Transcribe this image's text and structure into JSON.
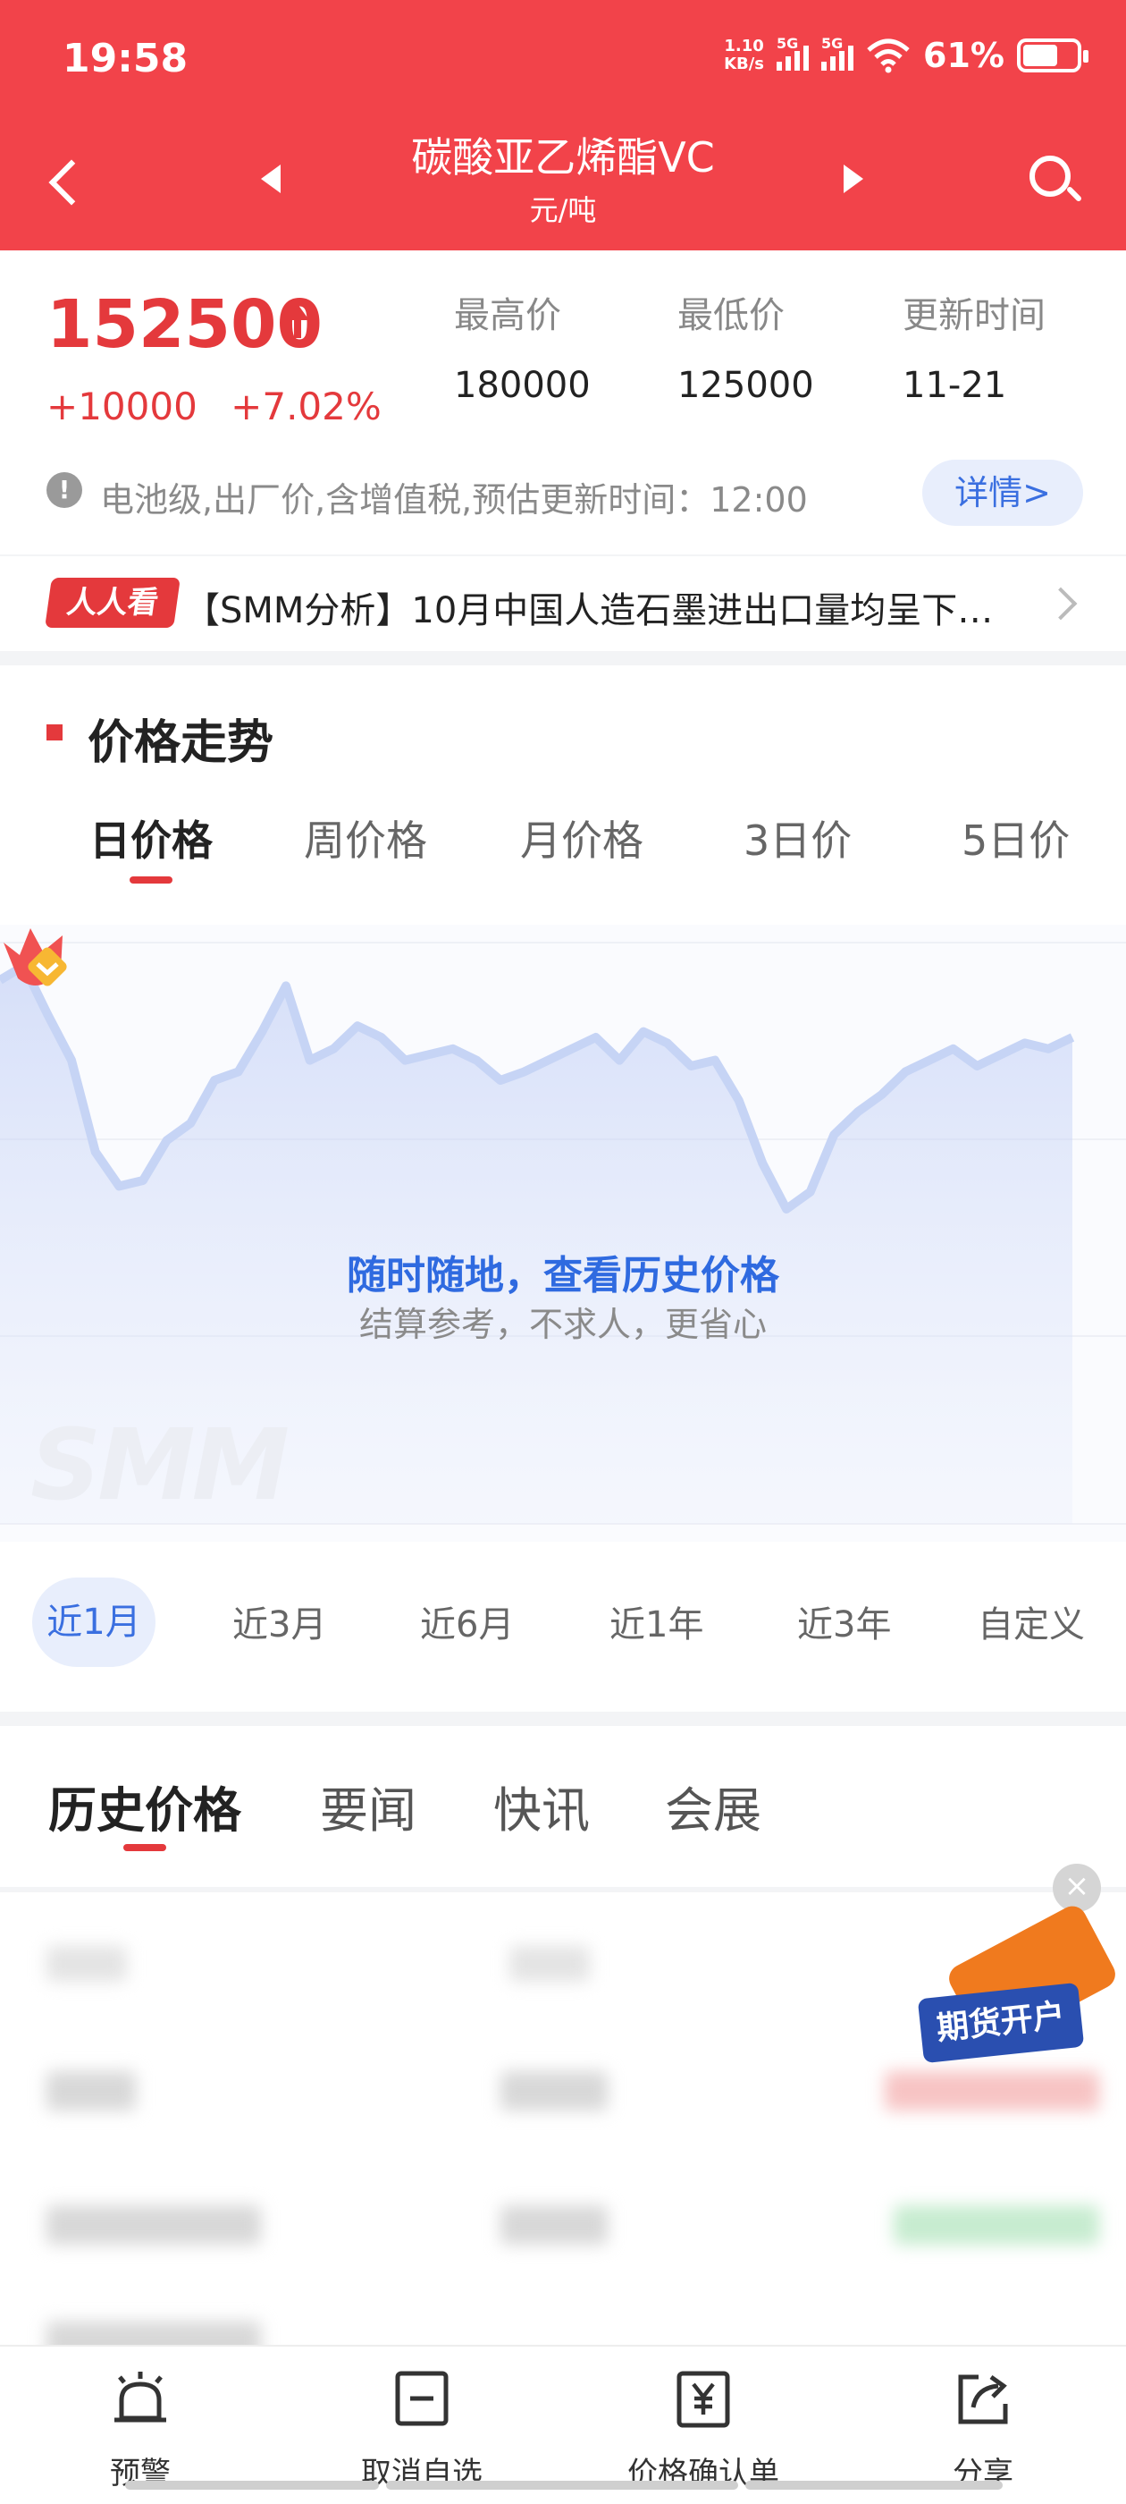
{
  "status_bar": {
    "time": "19:58",
    "net_speed_value": "1.10",
    "net_speed_unit": "KB/s",
    "signal_1": "5G",
    "signal_2": "5G",
    "battery": "61%"
  },
  "nav": {
    "title": "碳酸亚乙烯酯VC",
    "unit": "元/吨"
  },
  "price": {
    "current": "152500",
    "change": "+10000",
    "change_pct": "+7.02%",
    "high_label": "最高价",
    "high_value": "180000",
    "low_label": "最低价",
    "low_value": "125000",
    "update_label": "更新时间",
    "update_value": "11-21",
    "note": "电池级,出厂价,含增值税,预估更新时间：12:00",
    "detail_button": "详情>"
  },
  "ticker": {
    "badge": "人人看",
    "text": "【SMM分析】10月中国人造石墨进出口量均呈下…"
  },
  "trend": {
    "section_title": "价格走势",
    "period_tabs": [
      "日价格",
      "周价格",
      "月价格",
      "3日价",
      "5日价"
    ],
    "active_period": 0,
    "overlay_title": "随时随地，查看历史价格",
    "overlay_subtitle": "结算参考，不求人，更省心",
    "range_tabs": [
      "近1月",
      "近3月",
      "近6月",
      "近1年",
      "近3年",
      "自定义"
    ],
    "active_range": 0
  },
  "chart_data": {
    "type": "area",
    "series": [
      {
        "values": [
          0.9,
          0.95,
          0.78,
          0.62,
          0.3,
          0.18,
          0.2,
          0.34,
          0.4,
          0.55,
          0.58,
          0.72,
          0.88,
          0.62,
          0.66,
          0.74,
          0.7,
          0.62,
          0.64,
          0.66,
          0.62,
          0.55,
          0.58,
          0.62,
          0.66,
          0.7,
          0.62,
          0.72,
          0.68,
          0.6,
          0.62,
          0.48,
          0.26,
          0.1,
          0.16,
          0.36,
          0.44,
          0.5,
          0.58,
          0.62,
          0.66,
          0.6,
          0.64,
          0.68,
          0.66,
          0.7
        ]
      }
    ]
  },
  "info_tabs": {
    "tabs": [
      "历史价格",
      "要闻",
      "快讯",
      "会展"
    ],
    "active": 0
  },
  "promo": {
    "label": "期货开户",
    "close": "×"
  },
  "bottom_bar": {
    "items": [
      "预警",
      "取消自选",
      "价格确认单",
      "分享"
    ]
  }
}
